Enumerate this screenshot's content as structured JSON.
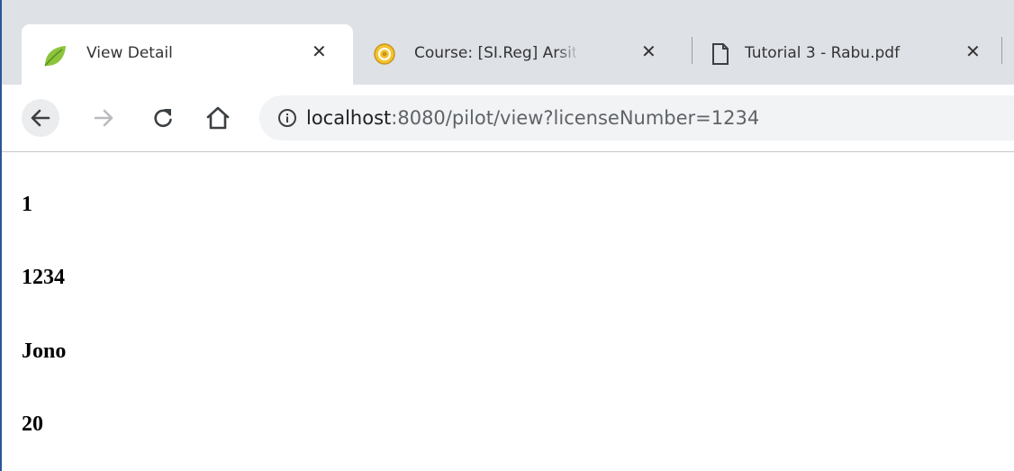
{
  "browser": {
    "tabs": [
      {
        "title": "View Detail",
        "icon": "leaf-icon",
        "active": true
      },
      {
        "title": "Course: [SI.Reg] Arsitek",
        "icon": "university-seal-icon",
        "active": false
      },
      {
        "title": "Tutorial 3 - Rabu.pdf",
        "icon": "document-icon",
        "active": false
      }
    ],
    "close_glyph": "✕",
    "url_host": "localhost",
    "url_rest": ":8080/pilot/view?licenseNumber=1234"
  },
  "page": {
    "id": "1",
    "license_number": "1234",
    "name": "Jono",
    "flight_hour": "20"
  },
  "colors": {
    "tabstrip": "#dee1e6",
    "omnibox": "#f1f3f4",
    "leaf": "#8cc43c"
  }
}
